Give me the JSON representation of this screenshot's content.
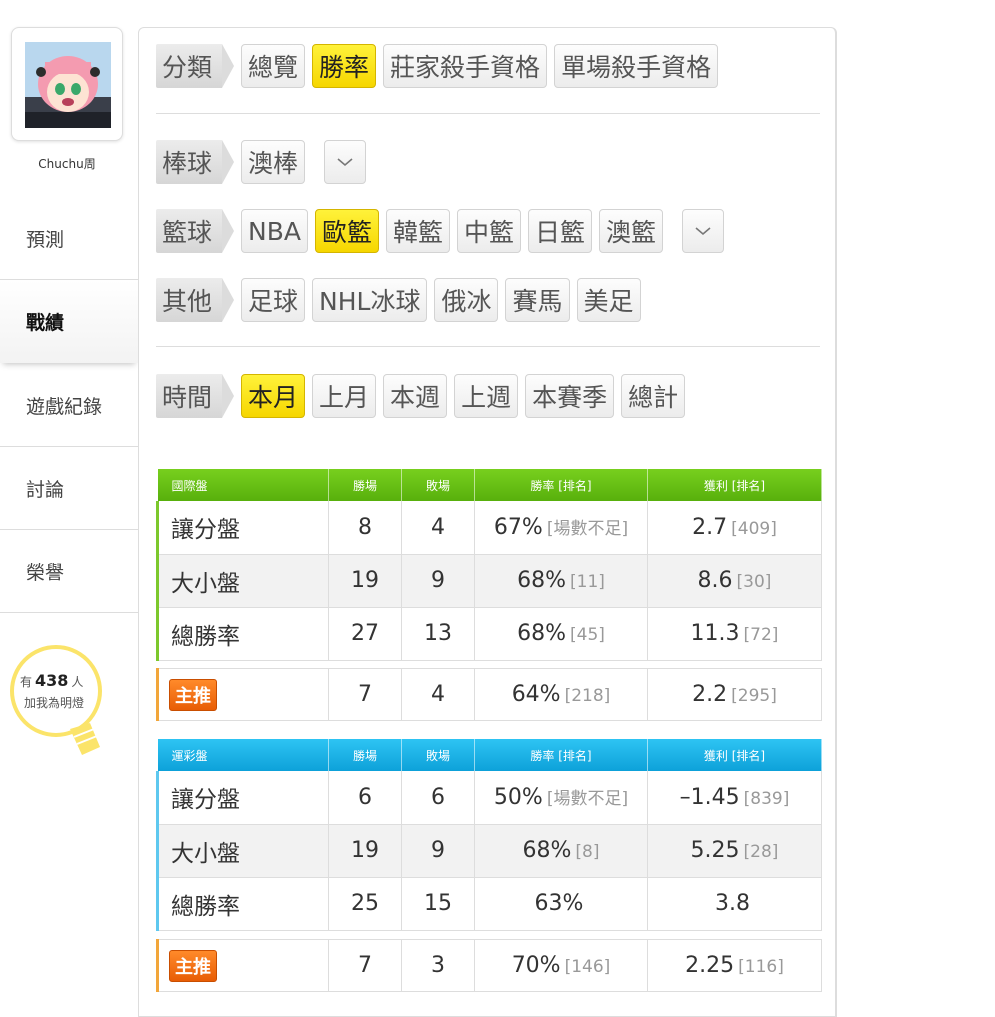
{
  "user": {
    "name": "Chuchu周"
  },
  "nav": [
    {
      "label": "預測"
    },
    {
      "label": "戰績"
    },
    {
      "label": "遊戲紀錄"
    },
    {
      "label": "討論"
    },
    {
      "label": "榮譽"
    }
  ],
  "fans": {
    "prefix": "有",
    "count": "438",
    "suffix": "人",
    "line2": "加我為明燈"
  },
  "filters": {
    "category": {
      "tag": "分類",
      "options": [
        "總覽",
        "勝率",
        "莊家殺手資格",
        "單場殺手資格"
      ],
      "selected": "勝率"
    },
    "baseball": {
      "tag": "棒球",
      "options": [
        "澳棒"
      ]
    },
    "basketball": {
      "tag": "籃球",
      "options": [
        "NBA",
        "歐籃",
        "韓籃",
        "中籃",
        "日籃",
        "澳籃"
      ],
      "selected": "歐籃"
    },
    "other": {
      "tag": "其他",
      "options": [
        "足球",
        "NHL冰球",
        "俄冰",
        "賽馬",
        "美足"
      ]
    },
    "time": {
      "tag": "時間",
      "options": [
        "本月",
        "上月",
        "本週",
        "上週",
        "本賽季",
        "總計"
      ],
      "selected": "本月"
    }
  },
  "colors": {
    "selected": "#f6d600",
    "intl_header": "#5ab40e",
    "lottery_header": "#12a6dc",
    "badge": "#e85d05"
  },
  "intl": {
    "headers": [
      "國際盤",
      "勝場",
      "敗場",
      "勝率 [排名]",
      "獲利 [排名]"
    ],
    "rows": [
      {
        "name": "讓分盤",
        "win": "8",
        "loss": "4",
        "rate": "67%",
        "rate_rank": "[場數不足]",
        "profit": "2.7",
        "profit_rank": "[409]"
      },
      {
        "name": "大小盤",
        "win": "19",
        "loss": "9",
        "rate": "68%",
        "rate_rank": "[11]",
        "profit": "8.6",
        "profit_rank": "[30]"
      },
      {
        "name": "總勝率",
        "win": "27",
        "loss": "13",
        "rate": "68%",
        "rate_rank": "[45]",
        "profit": "11.3",
        "profit_rank": "[72]"
      }
    ],
    "main": {
      "badge": "主推",
      "win": "7",
      "loss": "4",
      "rate": "64%",
      "rate_rank": "[218]",
      "profit": "2.2",
      "profit_rank": "[295]"
    }
  },
  "lottery": {
    "headers": [
      "運彩盤",
      "勝場",
      "敗場",
      "勝率 [排名]",
      "獲利 [排名]"
    ],
    "rows": [
      {
        "name": "讓分盤",
        "win": "6",
        "loss": "6",
        "rate": "50%",
        "rate_rank": "[場數不足]",
        "profit": "–1.45",
        "profit_rank": "[839]"
      },
      {
        "name": "大小盤",
        "win": "19",
        "loss": "9",
        "rate": "68%",
        "rate_rank": "[8]",
        "profit": "5.25",
        "profit_rank": "[28]"
      },
      {
        "name": "總勝率",
        "win": "25",
        "loss": "15",
        "rate": "63%",
        "rate_rank": "",
        "profit": "3.8",
        "profit_rank": ""
      }
    ],
    "main": {
      "badge": "主推",
      "win": "7",
      "loss": "3",
      "rate": "70%",
      "rate_rank": "[146]",
      "profit": "2.25",
      "profit_rank": "[116]"
    }
  }
}
